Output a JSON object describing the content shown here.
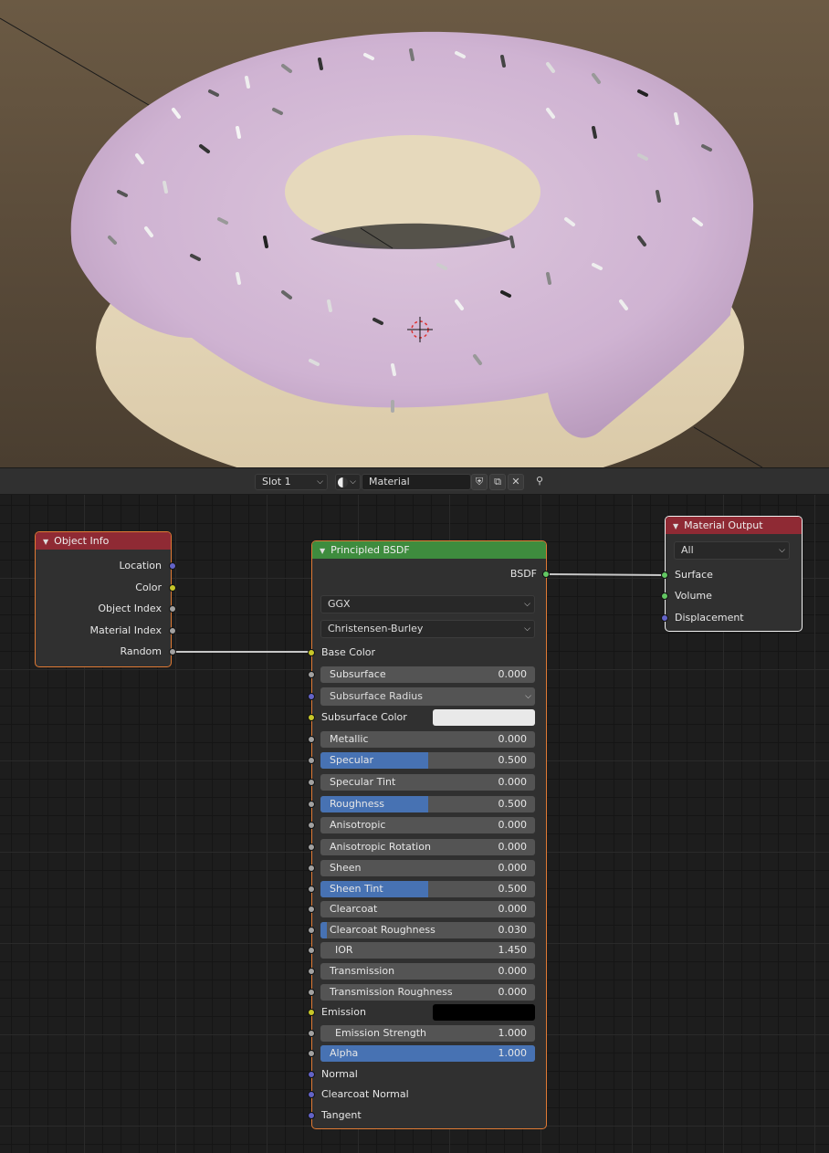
{
  "viewport": {
    "label": "3D Viewport"
  },
  "header": {
    "slot": "Slot 1",
    "material_name": "Material"
  },
  "nodes": {
    "object_info": {
      "title": "Object Info",
      "outputs": [
        "Location",
        "Color",
        "Object Index",
        "Material Index",
        "Random"
      ]
    },
    "principled": {
      "title": "Principled BSDF",
      "output": "BSDF",
      "distribution": "GGX",
      "subsurface_method": "Christensen-Burley",
      "inputs": [
        {
          "label": "Base Color",
          "kind": "socket"
        },
        {
          "label": "Subsurface",
          "kind": "value",
          "value": "0.000",
          "fill": 0
        },
        {
          "label": "Subsurface Radius",
          "kind": "dropdown"
        },
        {
          "label": "Subsurface Color",
          "kind": "color",
          "color": "#e9e9e9"
        },
        {
          "label": "Metallic",
          "kind": "value",
          "value": "0.000",
          "fill": 0
        },
        {
          "label": "Specular",
          "kind": "value",
          "value": "0.500",
          "fill": 0.5
        },
        {
          "label": "Specular Tint",
          "kind": "value",
          "value": "0.000",
          "fill": 0
        },
        {
          "label": "Roughness",
          "kind": "value",
          "value": "0.500",
          "fill": 0.5
        },
        {
          "label": "Anisotropic",
          "kind": "value",
          "value": "0.000",
          "fill": 0
        },
        {
          "label": "Anisotropic Rotation",
          "kind": "value",
          "value": "0.000",
          "fill": 0
        },
        {
          "label": "Sheen",
          "kind": "value",
          "value": "0.000",
          "fill": 0
        },
        {
          "label": "Sheen Tint",
          "kind": "value",
          "value": "0.500",
          "fill": 0.5
        },
        {
          "label": "Clearcoat",
          "kind": "value",
          "value": "0.000",
          "fill": 0
        },
        {
          "label": "Clearcoat Roughness",
          "kind": "value",
          "value": "0.030",
          "fill": 0.03
        },
        {
          "label": "IOR",
          "kind": "value",
          "value": "1.450",
          "fill": 0
        },
        {
          "label": "Transmission",
          "kind": "value",
          "value": "0.000",
          "fill": 0
        },
        {
          "label": "Transmission Roughness",
          "kind": "value",
          "value": "0.000",
          "fill": 0
        },
        {
          "label": "Emission",
          "kind": "color",
          "color": "#000000"
        },
        {
          "label": "Emission Strength",
          "kind": "value",
          "value": "1.000",
          "fill": 0
        },
        {
          "label": "Alpha",
          "kind": "value",
          "value": "1.000",
          "fill": 1
        },
        {
          "label": "Normal",
          "kind": "socket"
        },
        {
          "label": "Clearcoat Normal",
          "kind": "socket"
        },
        {
          "label": "Tangent",
          "kind": "socket"
        }
      ]
    },
    "material_output": {
      "title": "Material Output",
      "target": "All",
      "inputs": [
        "Surface",
        "Volume",
        "Displacement"
      ]
    }
  },
  "colors": {
    "accent_blue": "#4772b3",
    "node_red_header": "#8f2a34",
    "node_green_header": "#3e8c3e",
    "selected_outline": "#e07a34"
  }
}
